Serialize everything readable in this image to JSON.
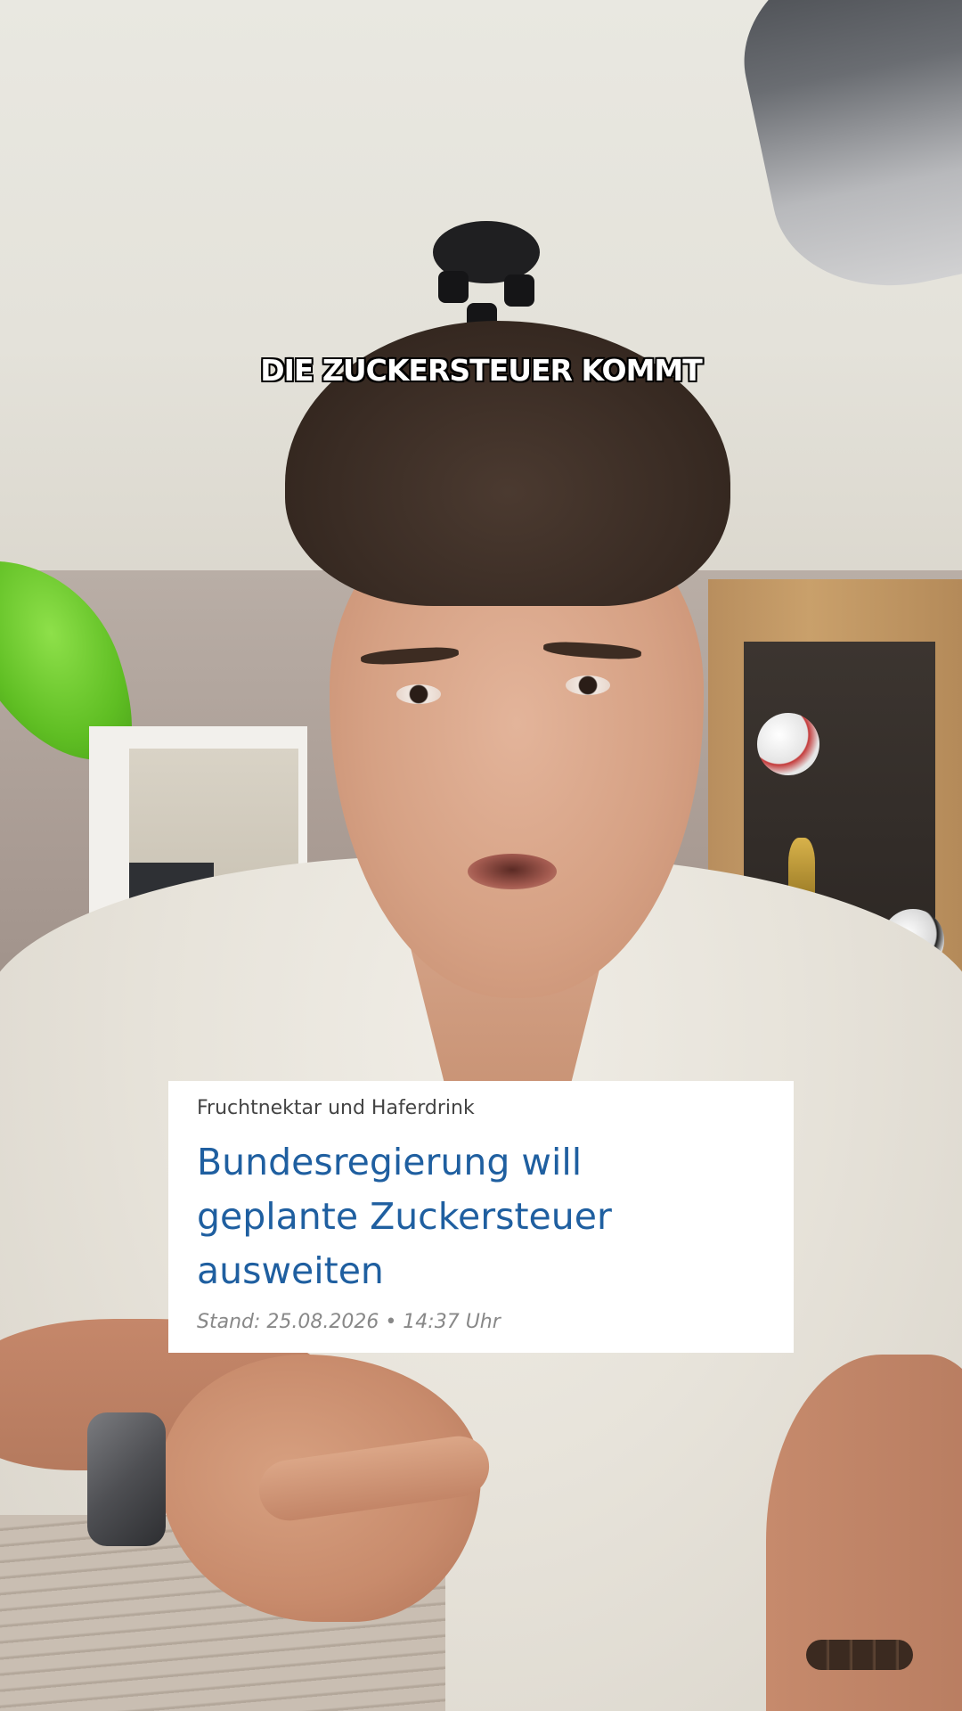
{
  "caption": "DIE ZUCKERSTEUER KOMMT",
  "news_card": {
    "kicker": "Fruchtnektar und Haferdrink",
    "headline": "Bundesregierung will geplante Zuckersteuer ausweiten",
    "date": "Stand: 25.08.2026 • 14:37 Uhr"
  },
  "colors": {
    "headline": "#1f5fa0",
    "card_background": "#ffffff",
    "caption_text": "#ffffff",
    "caption_outline": "#000000"
  }
}
